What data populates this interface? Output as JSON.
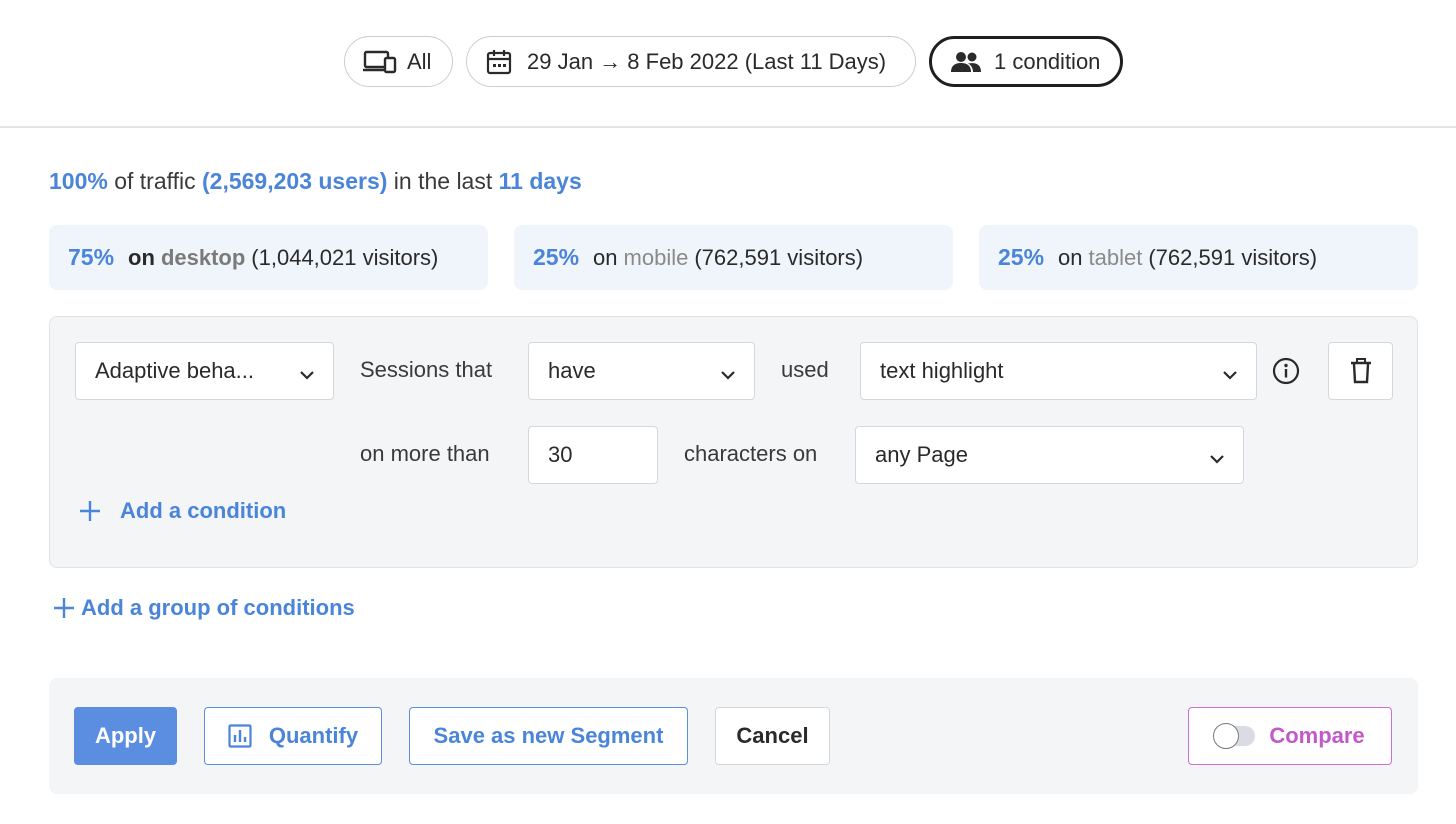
{
  "filters": {
    "device_label": "All",
    "date_range_label": "29 Jan → 8 Feb 2022 (Last 11 Days)",
    "condition_label": "1 condition"
  },
  "summary": {
    "pct": "100%",
    "of_traffic": "of traffic",
    "users": "(2,569,203 users)",
    "in_the_last": "in the last",
    "days": "11 days"
  },
  "devices": [
    {
      "pct": "75%",
      "on": "on",
      "device": "desktop",
      "visitors": "(1,044,021 visitors)"
    },
    {
      "pct": "25%",
      "on": "on",
      "device": "mobile",
      "visitors": "(762,591 visitors)"
    },
    {
      "pct": "25%",
      "on": "on",
      "device": "tablet",
      "visitors": "(762,591 visitors)"
    }
  ],
  "condition": {
    "category": "Adaptive beha...",
    "sessions_that": "Sessions that",
    "verb": "have",
    "used": "used",
    "feature": "text highlight",
    "on_more_than": "on more than",
    "threshold": "30",
    "characters_on": "characters on",
    "page": "any Page",
    "add_condition": "Add a condition"
  },
  "add_group": "Add a group of conditions",
  "footer": {
    "apply": "Apply",
    "quantify": "Quantify",
    "save_segment": "Save as new Segment",
    "cancel": "Cancel",
    "compare": "Compare",
    "compare_on": false
  },
  "colors": {
    "accent": "#4a85d9",
    "primary_button": "#5b8ee0",
    "compare": "#c15ac8",
    "panel_bg": "#f4f5f7",
    "stat_bg": "#f0f4fb"
  }
}
